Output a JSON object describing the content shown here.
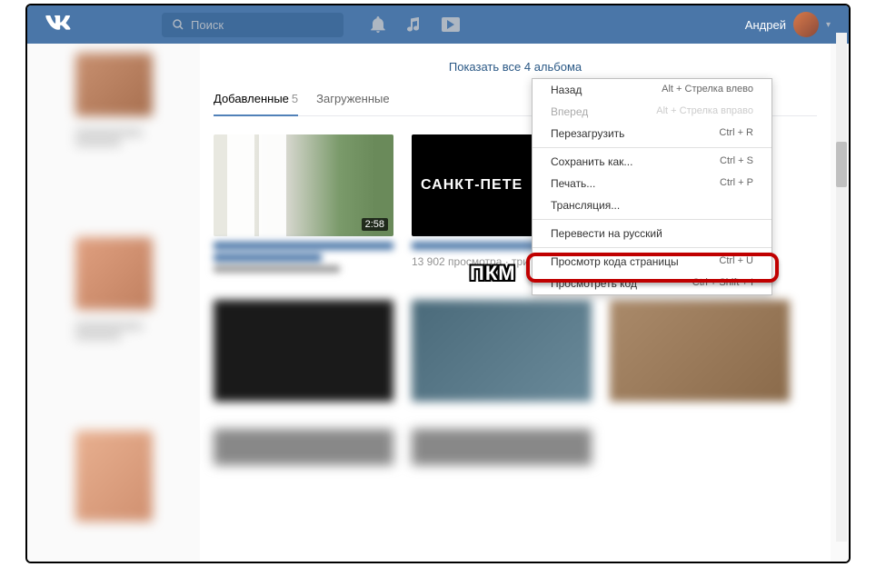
{
  "header": {
    "search_placeholder": "Поиск",
    "username": "Андрей"
  },
  "main": {
    "show_all": "Показать все 4 альбома",
    "tabs": {
      "added": {
        "label": "Добавленные",
        "count": "5"
      },
      "uploaded": {
        "label": "Загруженные"
      }
    },
    "video1": {
      "duration": "2:58"
    },
    "video2": {
      "thumb_text": "САНКТ-ПЕТЕ",
      "meta": "13 902 просмотра · три часа назад"
    }
  },
  "context_menu": {
    "back": {
      "label": "Назад",
      "shortcut": "Alt + Стрелка влево"
    },
    "forward": {
      "label": "Вперед",
      "shortcut": "Alt + Стрелка вправо"
    },
    "reload": {
      "label": "Перезагрузить",
      "shortcut": "Ctrl + R"
    },
    "save_as": {
      "label": "Сохранить как...",
      "shortcut": "Ctrl + S"
    },
    "print": {
      "label": "Печать...",
      "shortcut": "Ctrl + P"
    },
    "cast": {
      "label": "Трансляция..."
    },
    "translate": {
      "label": "Перевести на русский"
    },
    "view_source": {
      "label": "Просмотр кода страницы",
      "shortcut": "Ctrl + U"
    },
    "inspect": {
      "label": "Просмотреть код",
      "shortcut": "Ctrl + Shift + I"
    }
  },
  "annotation": {
    "pkm": "ПКМ"
  }
}
